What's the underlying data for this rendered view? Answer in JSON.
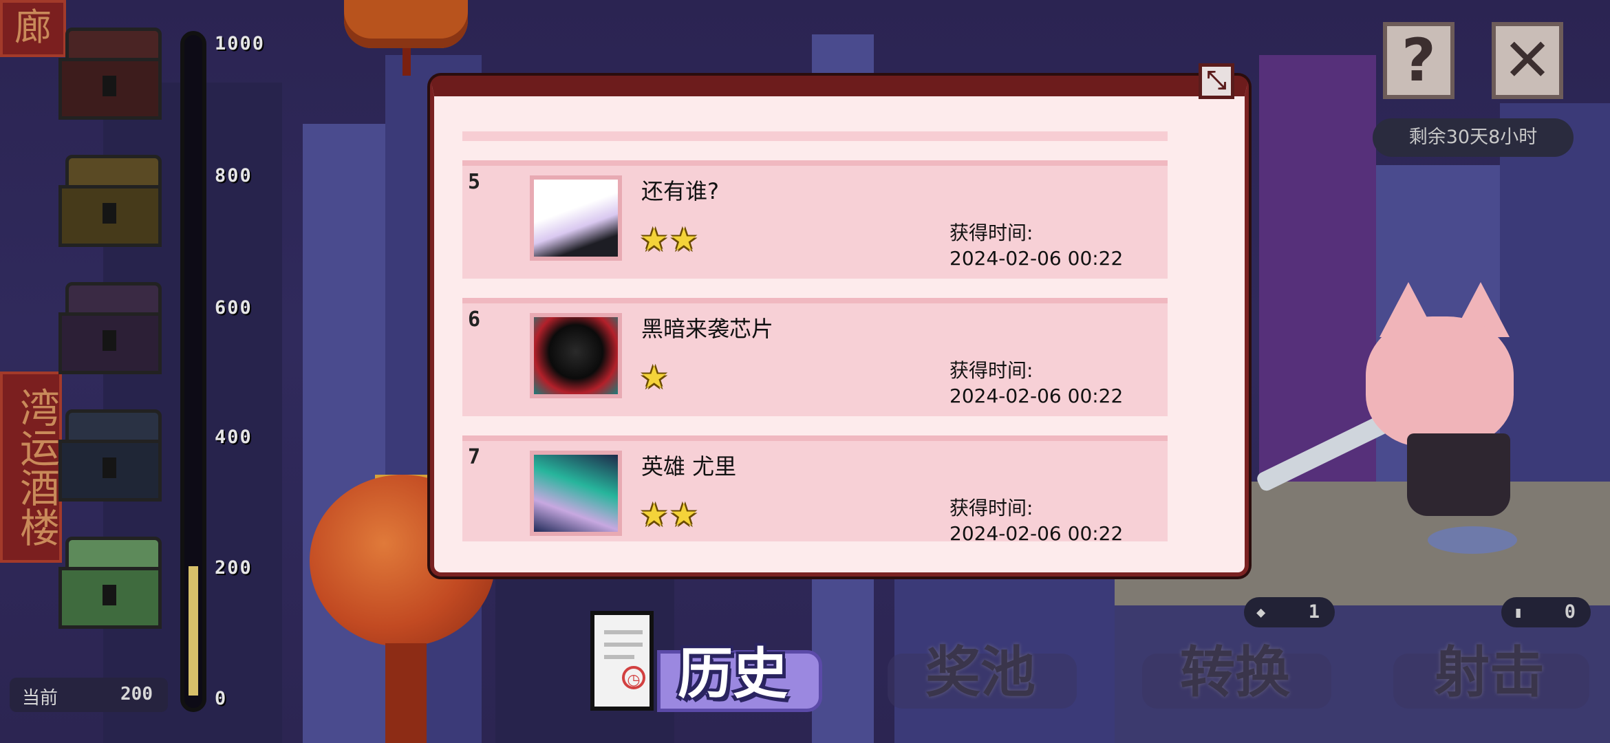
{
  "scene": {
    "sign_top": "廊",
    "sign_left": "湾运酒楼"
  },
  "progress": {
    "ticks": [
      "1000",
      "800",
      "600",
      "400",
      "200",
      "0"
    ],
    "current_label": "当前",
    "current_value": "200",
    "fill_fraction": 0.2
  },
  "top_right": {
    "help_icon": "question-mark",
    "close_icon": "x-mark",
    "timer": "剩余30天8小时"
  },
  "resources": [
    {
      "icon": "gem-icon",
      "value": "1"
    },
    {
      "icon": "bottle-icon",
      "value": "0"
    }
  ],
  "tabs": [
    {
      "label": "历史",
      "active": true
    },
    {
      "label": "奖池",
      "active": false
    },
    {
      "label": "转换",
      "active": false
    },
    {
      "label": "射击",
      "active": false
    }
  ],
  "history": {
    "close_icon": "collapse-icon",
    "items": [
      {
        "index": "5",
        "name": "还有谁?",
        "stars": "★★",
        "time_label": "获得时间:",
        "time": "2024-02-06 00:22"
      },
      {
        "index": "6",
        "name": "黑暗来袭芯片",
        "stars": "★",
        "time_label": "获得时间:",
        "time": "2024-02-06 00:22"
      },
      {
        "index": "7",
        "name": "英雄 尤里",
        "stars": "★★",
        "time_label": "获得时间:",
        "time": "2024-02-06 00:22"
      }
    ]
  },
  "colors": {
    "dialog_bg": "#fdebec",
    "dialog_border": "#6d1c1c",
    "row_bg": "#f7d0d6",
    "star": "#f4d33a",
    "active_tab": "#9b88e0"
  }
}
